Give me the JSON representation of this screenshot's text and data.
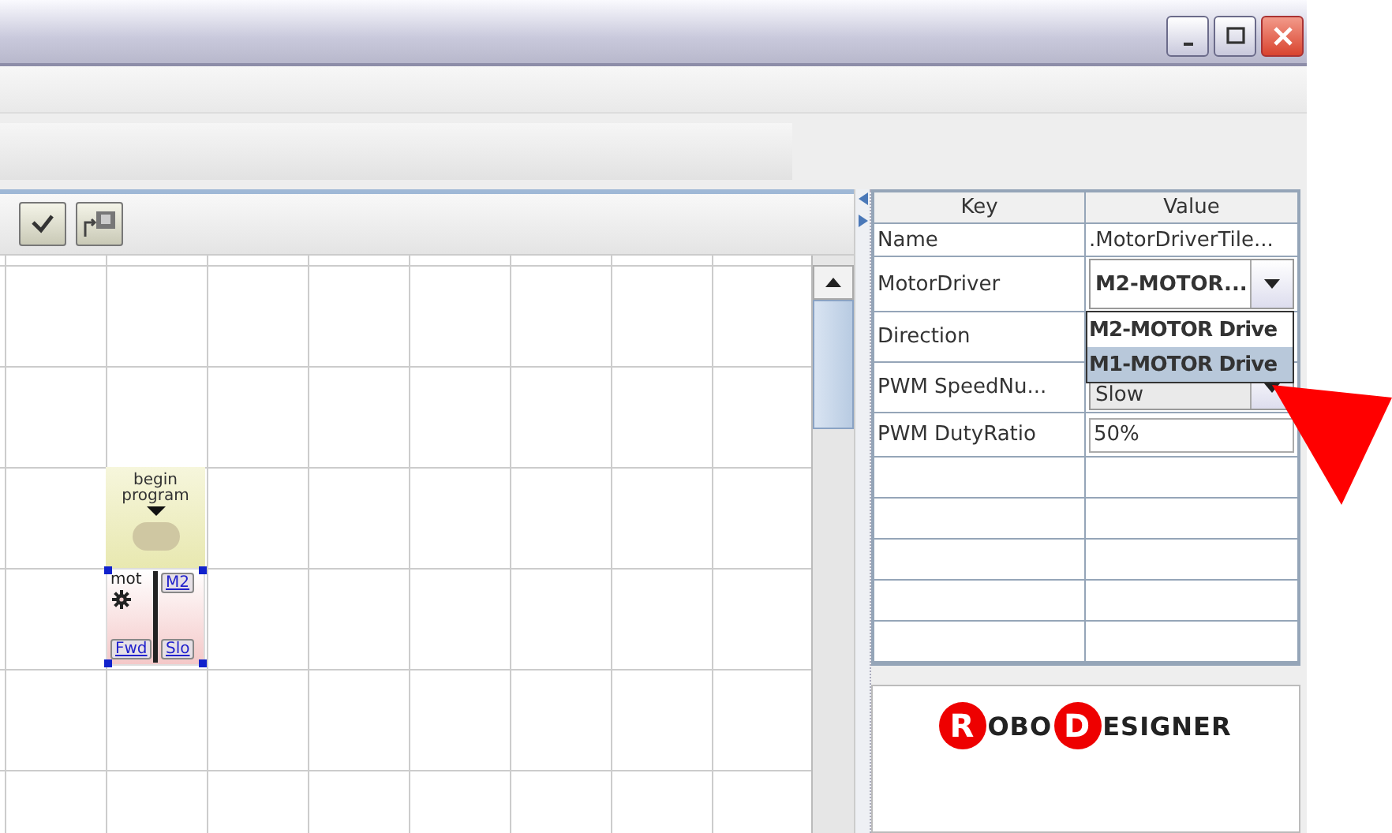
{
  "window": {
    "controls": [
      {
        "kind": "minimize"
      },
      {
        "kind": "maximize"
      },
      {
        "kind": "close"
      }
    ]
  },
  "canvas": {
    "tiles": [
      {
        "kind": "begin",
        "label": "begin program"
      },
      {
        "kind": "motor",
        "label": "mot",
        "driver": "M2",
        "direction": "Fwd",
        "speed": "Slo",
        "selected": true
      }
    ]
  },
  "properties": {
    "columns": [
      "Key",
      "Value"
    ],
    "rows": [
      {
        "key": "Name",
        "value": ".MotorDriverTile...",
        "kind": "text"
      },
      {
        "key": "MotorDriver",
        "value": "M2-MOTOR...",
        "kind": "combo"
      },
      {
        "key": "Direction",
        "kind": "hidden"
      },
      {
        "key": "PWM SpeedNu...",
        "value": "Slow",
        "kind": "combo"
      },
      {
        "key": "PWM DutyRatio",
        "value": "50%",
        "kind": "field"
      }
    ],
    "popup": [
      {
        "text": "M2-MOTOR Drive",
        "selected": false
      },
      {
        "text": "M1-MOTOR Drive",
        "selected": true
      }
    ]
  },
  "logo": [
    {
      "text": "R",
      "circled": true
    },
    {
      "text": "OBO",
      "circled": false
    },
    {
      "text": "D",
      "circled": true
    },
    {
      "text": "ESIGNER",
      "circled": false
    }
  ]
}
